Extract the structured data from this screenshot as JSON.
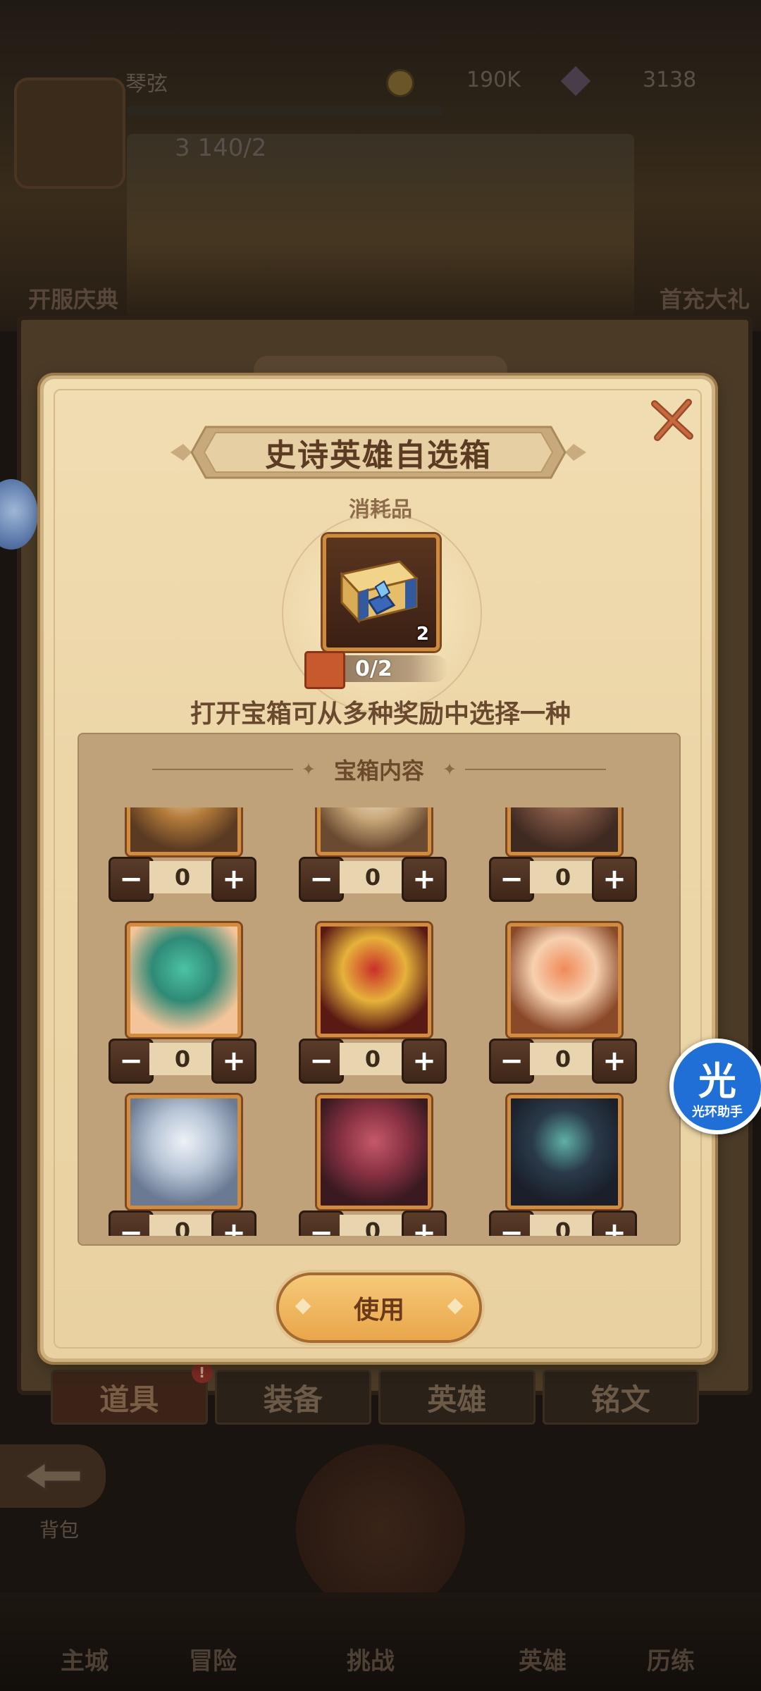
{
  "header": {
    "player_name": "琴弦",
    "level_text": "3 140/2",
    "coins": "190K",
    "gems": "3138",
    "left_event": "开服庆典",
    "right_event": "首充大礼"
  },
  "bag": {
    "tabs": [
      {
        "label": "道具",
        "badge": "!"
      },
      {
        "label": "装备"
      },
      {
        "label": "英雄"
      },
      {
        "label": "铭文"
      }
    ],
    "back_label": "背包"
  },
  "bottom_nav": [
    "主城",
    "冒险",
    "挑战",
    "英雄",
    "历练"
  ],
  "modal": {
    "title": "史诗英雄自选箱",
    "subtitle": "消耗品",
    "item_count": "2",
    "progress": "0/2",
    "description": "打开宝箱可从多种奖励中选择一种",
    "contents_title": "宝箱内容",
    "use_label": "使用"
  },
  "heroes": [
    {
      "name": "hero-paladin",
      "value": "0",
      "colors": [
        "#f0d9b0",
        "#b27a3a",
        "#5a3a22"
      ]
    },
    {
      "name": "hero-sage",
      "value": "0",
      "colors": [
        "#f2e7d8",
        "#c9a87a",
        "#6a4a30"
      ]
    },
    {
      "name": "hero-huntress",
      "value": "0",
      "colors": [
        "#b3876a",
        "#7a5240",
        "#3e2a20"
      ]
    },
    {
      "name": "hero-dryad",
      "value": "0",
      "colors": [
        "#4cc2a4",
        "#2f8a76",
        "#f3c49a"
      ]
    },
    {
      "name": "hero-warrior",
      "value": "0",
      "colors": [
        "#c9302a",
        "#e6b23a",
        "#5a1a14"
      ]
    },
    {
      "name": "hero-dancer",
      "value": "0",
      "colors": [
        "#f08a58",
        "#f6d0b0",
        "#8a4a2a"
      ]
    },
    {
      "name": "hero-elf-mage",
      "value": "0",
      "colors": [
        "#eef2f6",
        "#b7c4d6",
        "#6a7a92"
      ]
    },
    {
      "name": "hero-demon-brute",
      "value": "0",
      "colors": [
        "#c45a6a",
        "#8a3244",
        "#3a1a20"
      ]
    },
    {
      "name": "hero-lich",
      "value": "0",
      "colors": [
        "#5fb0a6",
        "#2a3a4a",
        "#1a1f2a"
      ]
    }
  ],
  "assistant": {
    "glyph": "光",
    "label": "光环助手"
  }
}
